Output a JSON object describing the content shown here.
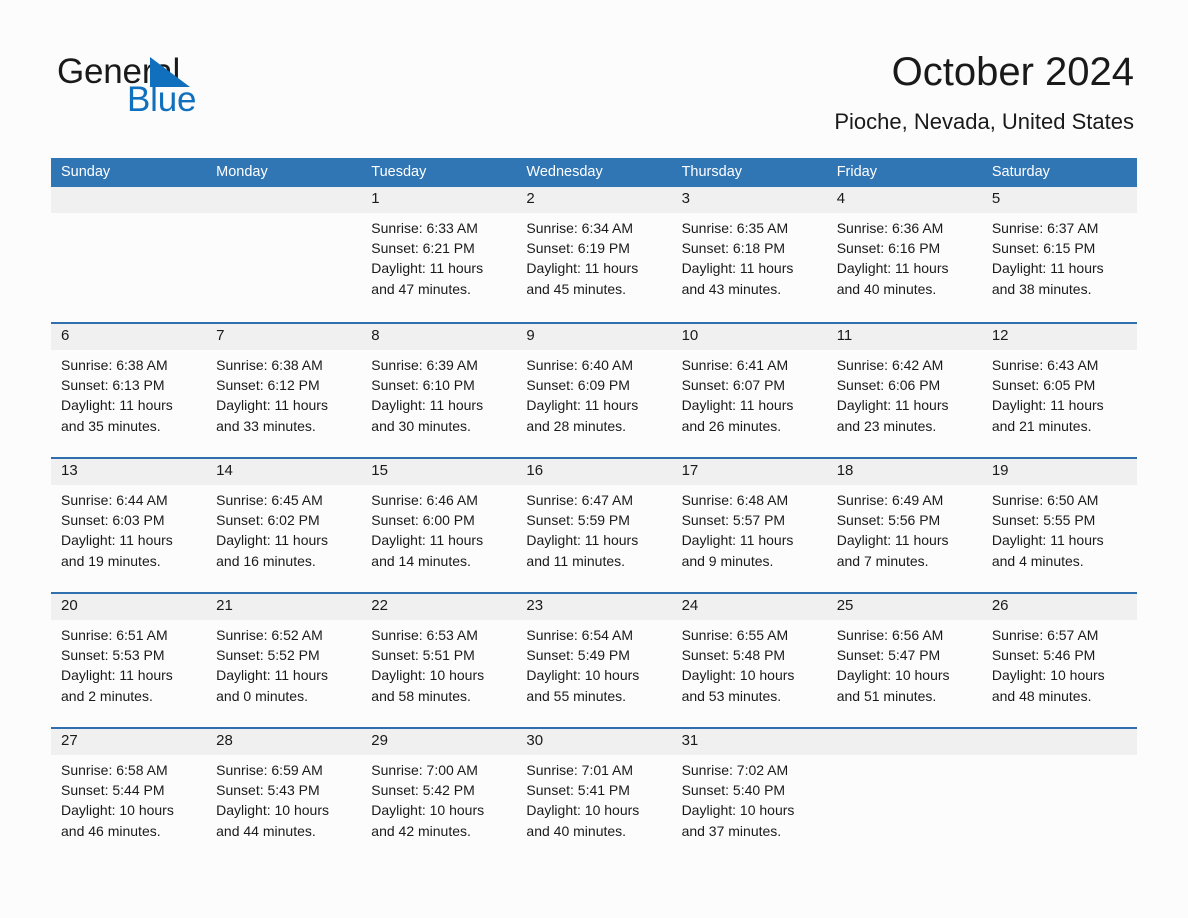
{
  "logo": {
    "part1": "General",
    "part2": "Blue",
    "triangle": "triangle-icon",
    "color_black": "#1a1a1a",
    "color_blue": "#1170bd"
  },
  "header": {
    "month_title": "October 2024",
    "location": "Pioche, Nevada, United States"
  },
  "colors": {
    "header_blue": "#3075b4",
    "row_divider_blue": "#2f6fad",
    "daynum_band": "#f0f0f0",
    "page_background": "#fcfcfc"
  },
  "weekdays": [
    "Sunday",
    "Monday",
    "Tuesday",
    "Wednesday",
    "Thursday",
    "Friday",
    "Saturday"
  ],
  "weeks": [
    [
      {
        "day": "",
        "sunrise": "",
        "sunset": "",
        "daylight1": "",
        "daylight2": ""
      },
      {
        "day": "",
        "sunrise": "",
        "sunset": "",
        "daylight1": "",
        "daylight2": ""
      },
      {
        "day": "1",
        "sunrise": "Sunrise: 6:33 AM",
        "sunset": "Sunset: 6:21 PM",
        "daylight1": "Daylight: 11 hours",
        "daylight2": "and 47 minutes."
      },
      {
        "day": "2",
        "sunrise": "Sunrise: 6:34 AM",
        "sunset": "Sunset: 6:19 PM",
        "daylight1": "Daylight: 11 hours",
        "daylight2": "and 45 minutes."
      },
      {
        "day": "3",
        "sunrise": "Sunrise: 6:35 AM",
        "sunset": "Sunset: 6:18 PM",
        "daylight1": "Daylight: 11 hours",
        "daylight2": "and 43 minutes."
      },
      {
        "day": "4",
        "sunrise": "Sunrise: 6:36 AM",
        "sunset": "Sunset: 6:16 PM",
        "daylight1": "Daylight: 11 hours",
        "daylight2": "and 40 minutes."
      },
      {
        "day": "5",
        "sunrise": "Sunrise: 6:37 AM",
        "sunset": "Sunset: 6:15 PM",
        "daylight1": "Daylight: 11 hours",
        "daylight2": "and 38 minutes."
      }
    ],
    [
      {
        "day": "6",
        "sunrise": "Sunrise: 6:38 AM",
        "sunset": "Sunset: 6:13 PM",
        "daylight1": "Daylight: 11 hours",
        "daylight2": "and 35 minutes."
      },
      {
        "day": "7",
        "sunrise": "Sunrise: 6:38 AM",
        "sunset": "Sunset: 6:12 PM",
        "daylight1": "Daylight: 11 hours",
        "daylight2": "and 33 minutes."
      },
      {
        "day": "8",
        "sunrise": "Sunrise: 6:39 AM",
        "sunset": "Sunset: 6:10 PM",
        "daylight1": "Daylight: 11 hours",
        "daylight2": "and 30 minutes."
      },
      {
        "day": "9",
        "sunrise": "Sunrise: 6:40 AM",
        "sunset": "Sunset: 6:09 PM",
        "daylight1": "Daylight: 11 hours",
        "daylight2": "and 28 minutes."
      },
      {
        "day": "10",
        "sunrise": "Sunrise: 6:41 AM",
        "sunset": "Sunset: 6:07 PM",
        "daylight1": "Daylight: 11 hours",
        "daylight2": "and 26 minutes."
      },
      {
        "day": "11",
        "sunrise": "Sunrise: 6:42 AM",
        "sunset": "Sunset: 6:06 PM",
        "daylight1": "Daylight: 11 hours",
        "daylight2": "and 23 minutes."
      },
      {
        "day": "12",
        "sunrise": "Sunrise: 6:43 AM",
        "sunset": "Sunset: 6:05 PM",
        "daylight1": "Daylight: 11 hours",
        "daylight2": "and 21 minutes."
      }
    ],
    [
      {
        "day": "13",
        "sunrise": "Sunrise: 6:44 AM",
        "sunset": "Sunset: 6:03 PM",
        "daylight1": "Daylight: 11 hours",
        "daylight2": "and 19 minutes."
      },
      {
        "day": "14",
        "sunrise": "Sunrise: 6:45 AM",
        "sunset": "Sunset: 6:02 PM",
        "daylight1": "Daylight: 11 hours",
        "daylight2": "and 16 minutes."
      },
      {
        "day": "15",
        "sunrise": "Sunrise: 6:46 AM",
        "sunset": "Sunset: 6:00 PM",
        "daylight1": "Daylight: 11 hours",
        "daylight2": "and 14 minutes."
      },
      {
        "day": "16",
        "sunrise": "Sunrise: 6:47 AM",
        "sunset": "Sunset: 5:59 PM",
        "daylight1": "Daylight: 11 hours",
        "daylight2": "and 11 minutes."
      },
      {
        "day": "17",
        "sunrise": "Sunrise: 6:48 AM",
        "sunset": "Sunset: 5:57 PM",
        "daylight1": "Daylight: 11 hours",
        "daylight2": "and 9 minutes."
      },
      {
        "day": "18",
        "sunrise": "Sunrise: 6:49 AM",
        "sunset": "Sunset: 5:56 PM",
        "daylight1": "Daylight: 11 hours",
        "daylight2": "and 7 minutes."
      },
      {
        "day": "19",
        "sunrise": "Sunrise: 6:50 AM",
        "sunset": "Sunset: 5:55 PM",
        "daylight1": "Daylight: 11 hours",
        "daylight2": "and 4 minutes."
      }
    ],
    [
      {
        "day": "20",
        "sunrise": "Sunrise: 6:51 AM",
        "sunset": "Sunset: 5:53 PM",
        "daylight1": "Daylight: 11 hours",
        "daylight2": "and 2 minutes."
      },
      {
        "day": "21",
        "sunrise": "Sunrise: 6:52 AM",
        "sunset": "Sunset: 5:52 PM",
        "daylight1": "Daylight: 11 hours",
        "daylight2": "and 0 minutes."
      },
      {
        "day": "22",
        "sunrise": "Sunrise: 6:53 AM",
        "sunset": "Sunset: 5:51 PM",
        "daylight1": "Daylight: 10 hours",
        "daylight2": "and 58 minutes."
      },
      {
        "day": "23",
        "sunrise": "Sunrise: 6:54 AM",
        "sunset": "Sunset: 5:49 PM",
        "daylight1": "Daylight: 10 hours",
        "daylight2": "and 55 minutes."
      },
      {
        "day": "24",
        "sunrise": "Sunrise: 6:55 AM",
        "sunset": "Sunset: 5:48 PM",
        "daylight1": "Daylight: 10 hours",
        "daylight2": "and 53 minutes."
      },
      {
        "day": "25",
        "sunrise": "Sunrise: 6:56 AM",
        "sunset": "Sunset: 5:47 PM",
        "daylight1": "Daylight: 10 hours",
        "daylight2": "and 51 minutes."
      },
      {
        "day": "26",
        "sunrise": "Sunrise: 6:57 AM",
        "sunset": "Sunset: 5:46 PM",
        "daylight1": "Daylight: 10 hours",
        "daylight2": "and 48 minutes."
      }
    ],
    [
      {
        "day": "27",
        "sunrise": "Sunrise: 6:58 AM",
        "sunset": "Sunset: 5:44 PM",
        "daylight1": "Daylight: 10 hours",
        "daylight2": "and 46 minutes."
      },
      {
        "day": "28",
        "sunrise": "Sunrise: 6:59 AM",
        "sunset": "Sunset: 5:43 PM",
        "daylight1": "Daylight: 10 hours",
        "daylight2": "and 44 minutes."
      },
      {
        "day": "29",
        "sunrise": "Sunrise: 7:00 AM",
        "sunset": "Sunset: 5:42 PM",
        "daylight1": "Daylight: 10 hours",
        "daylight2": "and 42 minutes."
      },
      {
        "day": "30",
        "sunrise": "Sunrise: 7:01 AM",
        "sunset": "Sunset: 5:41 PM",
        "daylight1": "Daylight: 10 hours",
        "daylight2": "and 40 minutes."
      },
      {
        "day": "31",
        "sunrise": "Sunrise: 7:02 AM",
        "sunset": "Sunset: 5:40 PM",
        "daylight1": "Daylight: 10 hours",
        "daylight2": "and 37 minutes."
      },
      {
        "day": "",
        "sunrise": "",
        "sunset": "",
        "daylight1": "",
        "daylight2": ""
      },
      {
        "day": "",
        "sunrise": "",
        "sunset": "",
        "daylight1": "",
        "daylight2": ""
      }
    ]
  ]
}
